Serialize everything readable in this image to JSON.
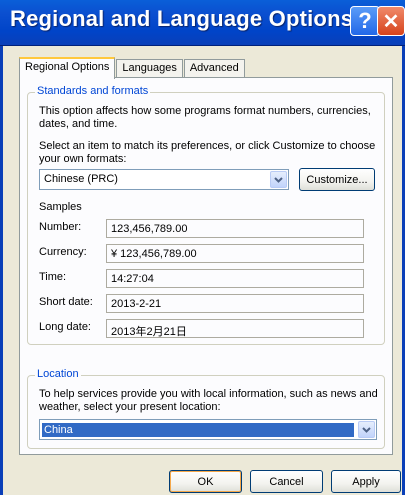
{
  "window": {
    "title": "Regional and Language Options",
    "help_glyph": "?",
    "close_glyph": "✕"
  },
  "tabs": [
    {
      "label": "Regional Options",
      "active": true
    },
    {
      "label": "Languages",
      "active": false
    },
    {
      "label": "Advanced",
      "active": false
    }
  ],
  "standards": {
    "legend": "Standards and formats",
    "description_line1": "This option affects how some programs format numbers, currencies,",
    "description_line2": "dates, and time.",
    "select_line1": "Select an item to match its preferences, or click Customize to choose",
    "select_line2": "your own formats:",
    "format_value": "Chinese (PRC)",
    "customize_label": "Customize..."
  },
  "samples": {
    "heading": "Samples",
    "rows": [
      {
        "label": "Number:",
        "value": "123,456,789.00"
      },
      {
        "label": "Currency:",
        "value": "¥ 123,456,789.00"
      },
      {
        "label": "Time:",
        "value": "14:27:04"
      },
      {
        "label": "Short date:",
        "value": "2013-2-21"
      },
      {
        "label": "Long date:",
        "value": "2013年2月21日"
      }
    ]
  },
  "location": {
    "legend": "Location",
    "description_line1": "To help services provide you with local information, such as news and",
    "description_line2": "weather, select your present location:",
    "value": "China"
  },
  "buttons": {
    "ok": "OK",
    "cancel": "Cancel",
    "apply": "Apply"
  },
  "colors": {
    "titlebar": "#0044c8",
    "accent_tab": "#ffc83c",
    "group_legend": "#0046d5",
    "selection": "#316ac5"
  }
}
